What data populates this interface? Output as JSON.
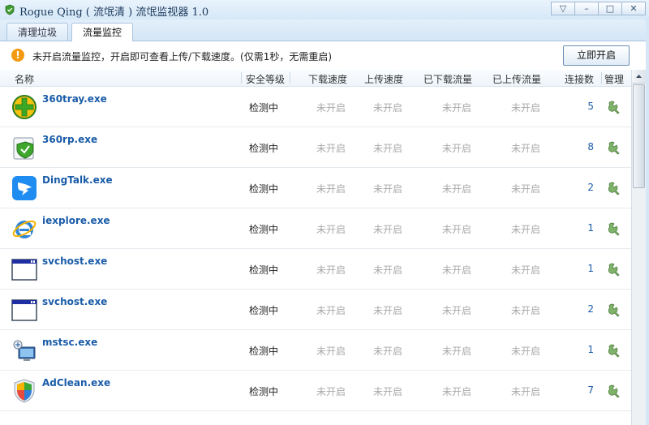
{
  "window": {
    "title": "Rogue Qing ( 流氓清 ) 流氓监视器 1.0",
    "controls": [
      "▽",
      "–",
      "□",
      "✕"
    ]
  },
  "tabs": [
    {
      "label": "清理垃圾",
      "active": false
    },
    {
      "label": "流量监控",
      "active": true
    }
  ],
  "notice": {
    "icon": "warning-icon",
    "text": "未开启流量监控，开启即可查看上传/下载速度。(仅需1秒，无需重启)",
    "button_label": "立即开启"
  },
  "table": {
    "columns": {
      "name": "名称",
      "security": "安全等级",
      "down_speed": "下载速度",
      "up_speed": "上传速度",
      "downloaded": "已下载流量",
      "uploaded": "已上传流量",
      "connections": "连接数",
      "manage": "管理"
    },
    "rows": [
      {
        "name": "360tray.exe",
        "icon": "360tray-icon",
        "security": "检测中",
        "down_speed": "未开启",
        "up_speed": "未开启",
        "downloaded": "未开启",
        "uploaded": "未开启",
        "connections": "5"
      },
      {
        "name": "360rp.exe",
        "icon": "360rp-icon",
        "security": "检测中",
        "down_speed": "未开启",
        "up_speed": "未开启",
        "downloaded": "未开启",
        "uploaded": "未开启",
        "connections": "8"
      },
      {
        "name": "DingTalk.exe",
        "icon": "dingtalk-icon",
        "security": "检测中",
        "down_speed": "未开启",
        "up_speed": "未开启",
        "downloaded": "未开启",
        "uploaded": "未开启",
        "connections": "2"
      },
      {
        "name": "iexplore.exe",
        "icon": "ie-icon",
        "security": "检测中",
        "down_speed": "未开启",
        "up_speed": "未开启",
        "downloaded": "未开启",
        "uploaded": "未开启",
        "connections": "1"
      },
      {
        "name": "svchost.exe",
        "icon": "window-app-icon",
        "security": "检测中",
        "down_speed": "未开启",
        "up_speed": "未开启",
        "downloaded": "未开启",
        "uploaded": "未开启",
        "connections": "1"
      },
      {
        "name": "svchost.exe",
        "icon": "window-app-icon",
        "security": "检测中",
        "down_speed": "未开启",
        "up_speed": "未开启",
        "downloaded": "未开启",
        "uploaded": "未开启",
        "connections": "2"
      },
      {
        "name": "mstsc.exe",
        "icon": "remote-desktop-icon",
        "security": "检测中",
        "down_speed": "未开启",
        "up_speed": "未开启",
        "downloaded": "未开启",
        "uploaded": "未开启",
        "connections": "1"
      },
      {
        "name": "AdClean.exe",
        "icon": "adclean-shield-icon",
        "security": "检测中",
        "down_speed": "未开启",
        "up_speed": "未开启",
        "downloaded": "未开启",
        "uploaded": "未开启",
        "connections": "7"
      }
    ]
  }
}
